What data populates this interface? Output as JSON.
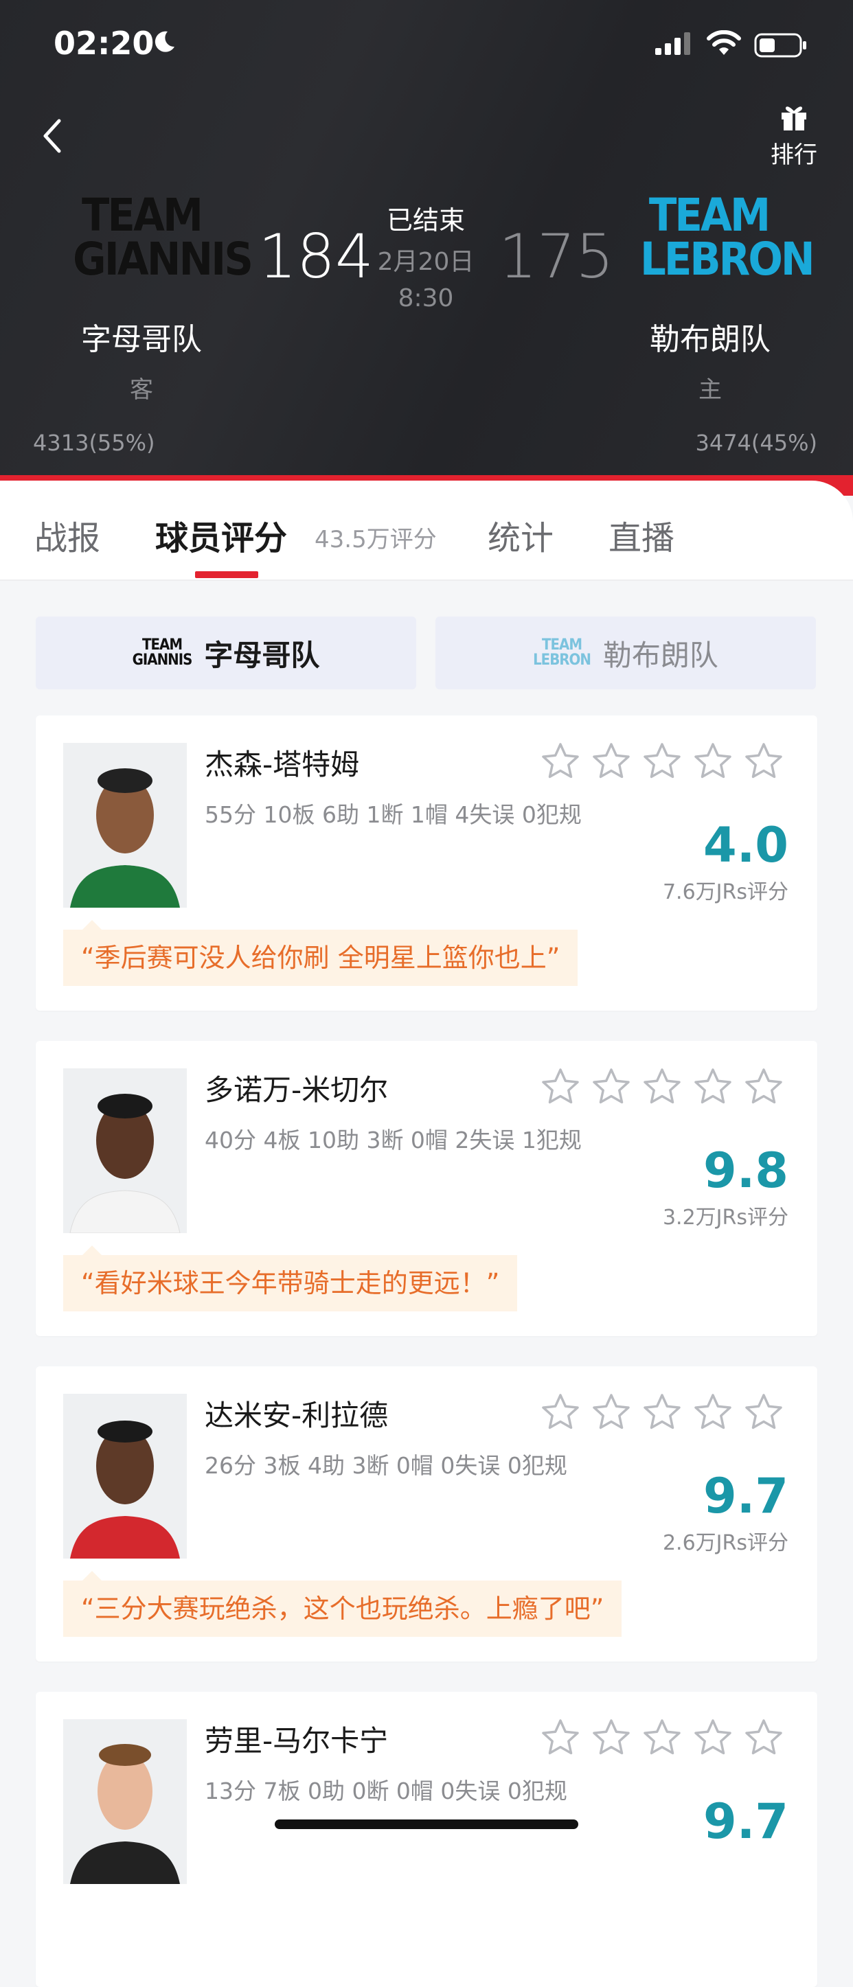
{
  "status_bar": {
    "time": "02:20"
  },
  "header": {
    "rank_label": "排行",
    "away": {
      "logo_line1": "TEAM",
      "logo_line2": "GIANNIS",
      "name": "字母哥队",
      "side": "客",
      "score": "184",
      "support": "4313(55%)",
      "logo_color": "#111111"
    },
    "home": {
      "logo_line1": "TEAM",
      "logo_line2": "LEBRON",
      "name": "勒布朗队",
      "side": "主",
      "score": "175",
      "support": "3474(45%)",
      "logo_color": "#1aa9d9"
    },
    "game_status": "已结束",
    "game_date": "2月20日",
    "game_time": "8:30"
  },
  "tabs": [
    {
      "label": "战报"
    },
    {
      "label": "球员评分",
      "active": true
    },
    {
      "label": "统计"
    },
    {
      "label": "直播"
    }
  ],
  "tab_note": "43.5万评分",
  "team_switch": {
    "away": {
      "logo_line1": "TEAM",
      "logo_line2": "GIANNIS",
      "label": "字母哥队",
      "selected": true
    },
    "home": {
      "logo_line1": "TEAM",
      "logo_line2": "LEBRON",
      "label": "勒布朗队",
      "selected": false
    }
  },
  "players": [
    {
      "name": "杰森-塔特姆",
      "stats": "55分 10板 6助 1断 1帽 4失误 0犯规",
      "rating": "4.0",
      "rating_count": "7.6万JRs评分",
      "comment": "“季后赛可没人给你刷 全明星上篮你也上”",
      "jersey_color": "#1f7a3c"
    },
    {
      "name": "多诺万-米切尔",
      "stats": "40分 4板 10助 3断 0帽 2失误 1犯规",
      "rating": "9.8",
      "rating_count": "3.2万JRs评分",
      "comment": "“看好米球王今年带骑士走的更远！”",
      "jersey_color": "#f4f4f4"
    },
    {
      "name": "达米安-利拉德",
      "stats": "26分 3板 4助 3断 0帽 0失误 0犯规",
      "rating": "9.7",
      "rating_count": "2.6万JRs评分",
      "comment": "“三分大赛玩绝杀，这个也玩绝杀。上瘾了吧”",
      "jersey_color": "#d3282e"
    },
    {
      "name": "劳里-马尔卡宁",
      "stats": "13分 7板 0助 0断 0帽 0失误 0犯规",
      "rating": "9.7",
      "rating_count": "",
      "comment": "",
      "jersey_color": "#222222"
    }
  ],
  "colors": {
    "accent_red": "#e3222f",
    "rating_teal": "#1b97a8",
    "comment_orange": "#e76d2a"
  }
}
